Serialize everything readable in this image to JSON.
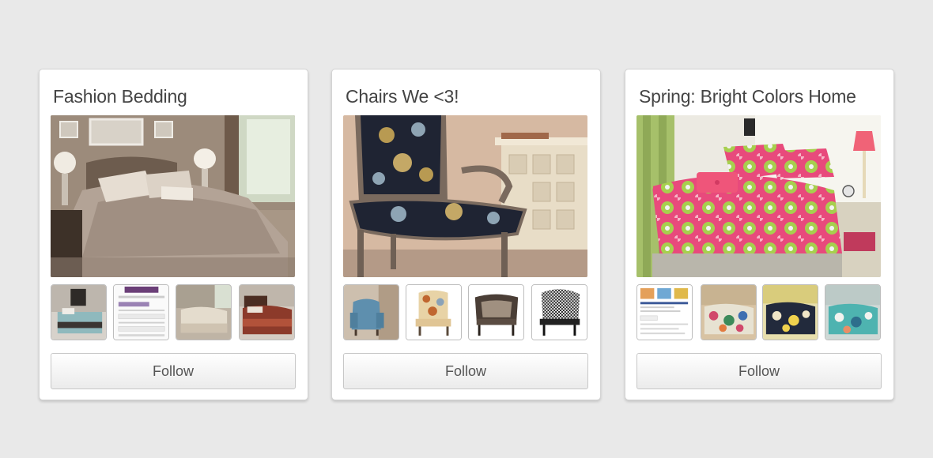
{
  "boards": [
    {
      "title": "Fashion Bedding",
      "cover_image": "bedroom-gray-pintuck-bedding-photo",
      "thumbnails": [
        "gray-teal-bedding-photo",
        "pinterest-signup-screenshot",
        "cream-bedding-photo",
        "brown-red-bedding-photo"
      ],
      "follow_label": "Follow"
    },
    {
      "title": "Chairs We <3!",
      "cover_image": "floral-accent-chair-photo",
      "thumbnails": [
        "blue-armchair-photo",
        "floral-slipper-chair-photo",
        "brown-club-chair-photo",
        "houndstooth-chair-photo"
      ],
      "follow_label": "Follow"
    },
    {
      "title": "Spring: Bright Colors Home",
      "cover_image": "pink-green-damask-bedding-photo",
      "thumbnails": [
        "product-page-screenshot",
        "floral-bedding-photo",
        "black-yellow-bedding-photo",
        "aqua-bedding-photo"
      ],
      "follow_label": "Follow"
    }
  ],
  "colors": {
    "page_background": "#e9e9e9",
    "card_background": "#ffffff",
    "title_text": "#444444",
    "button_text": "#555555"
  }
}
